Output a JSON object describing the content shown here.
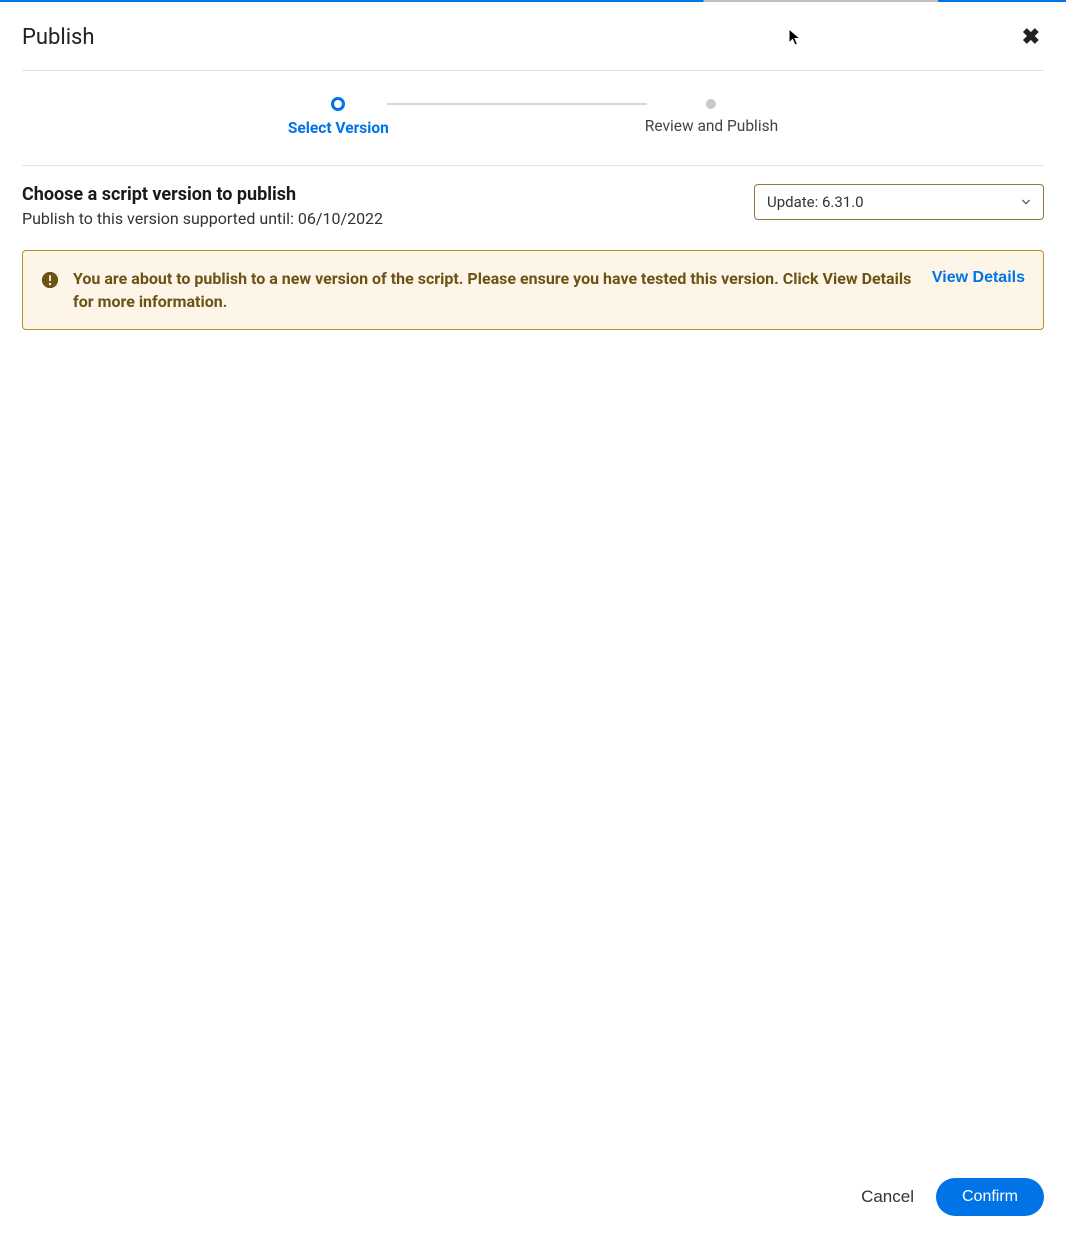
{
  "dialog": {
    "title": "Publish"
  },
  "stepper": {
    "step1_label": "Select Version",
    "step2_label": "Review and Publish"
  },
  "version": {
    "heading": "Choose a script version to publish",
    "supported_until_text": "Publish to this version supported until: 06/10/2022",
    "selected_option": "Update: 6.31.0"
  },
  "warning": {
    "message": "You are about to publish to a new version of the script. Please ensure you have tested this version. Click View Details for more information.",
    "view_details_label": "View Details"
  },
  "footer": {
    "cancel_label": "Cancel",
    "confirm_label": "Confirm"
  }
}
